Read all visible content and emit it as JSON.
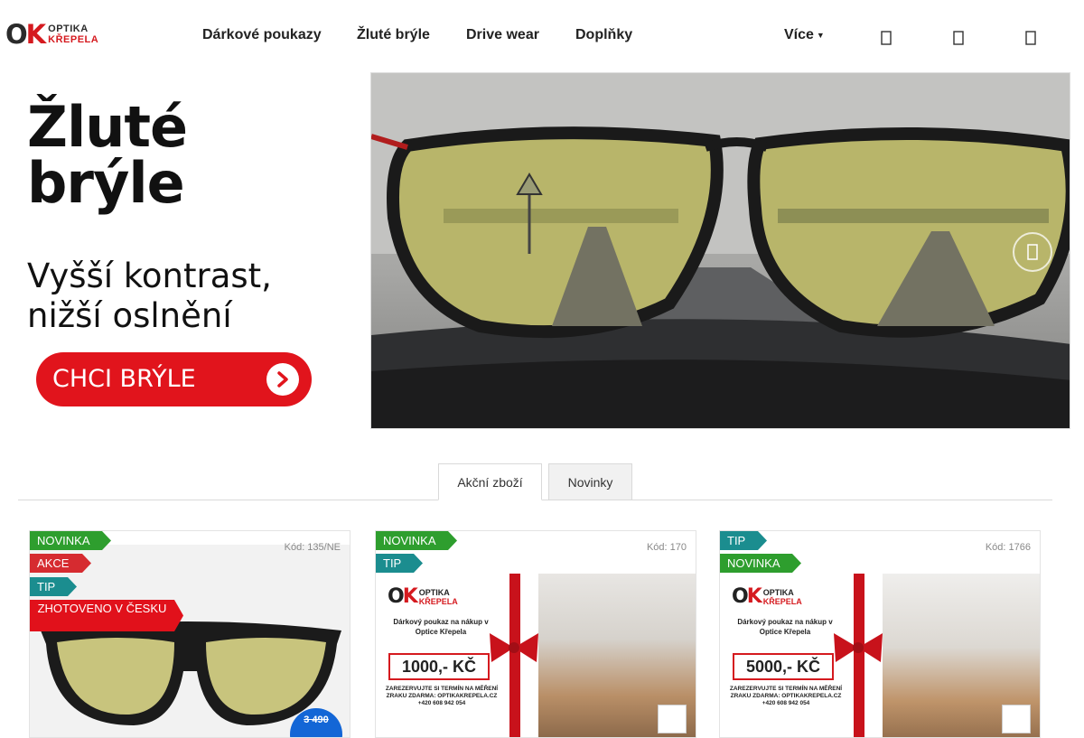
{
  "header": {
    "logo_ok": "OK",
    "logo_line1": "OPTIKA",
    "logo_line2": "KŘEPELA",
    "nav": [
      "Dárkové poukazy",
      "Žluté brýle",
      "Drive wear",
      "Doplňky"
    ],
    "more_label": "Více",
    "icons": [
      "search-icon",
      "user-icon",
      "cart-icon"
    ]
  },
  "banner": {
    "title_line1": "Žluté",
    "title_line2": "brýle",
    "subtitle_line1": "Vyšší kontrast,",
    "subtitle_line2": "nižší oslnění",
    "cta_label": "CHCI BRÝLE"
  },
  "tabs": [
    {
      "label": "Akční zboží",
      "active": true
    },
    {
      "label": "Novinky",
      "active": false
    }
  ],
  "products": [
    {
      "code": "Kód: 135/NE",
      "flags": [
        "NOVINKA",
        "AKCE",
        "TIP",
        "ZHOTOVENO V ČESKU"
      ],
      "price_old": "3 490"
    },
    {
      "code": "Kód: 170",
      "flags": [
        "NOVINKA",
        "TIP"
      ],
      "voucher": {
        "brand_line1": "OPTIKA",
        "brand_line2": "KŘEPELA",
        "desc": "Dárkový poukaz na nákup v Optice Křepela",
        "amount": "1000,- KČ",
        "note": "ZAREZERVUJTE SI TERMÍN NA MĚŘENÍ ZRAKU ZDARMA: OPTIKAKREPELA.CZ +420 608 942 054"
      }
    },
    {
      "code": "Kód: 1766",
      "flags": [
        "TIP",
        "NOVINKA"
      ],
      "voucher": {
        "brand_line1": "OPTIKA",
        "brand_line2": "KŘEPELA",
        "desc": "Dárkový poukaz na nákup v Optice Křepela",
        "amount": "5000,- KČ",
        "note": "ZAREZERVUJTE SI TERMÍN NA MĚŘENÍ ZRAKU ZDARMA: OPTIKAKREPELA.CZ +420 608 942 054"
      }
    }
  ]
}
